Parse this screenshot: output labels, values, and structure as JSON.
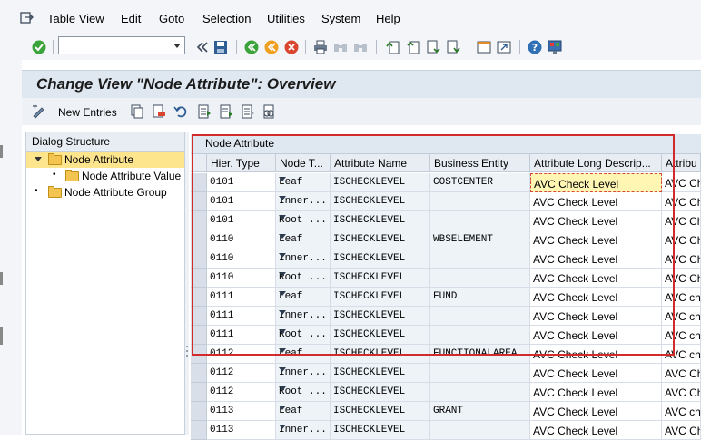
{
  "menu": {
    "items": [
      "Table View",
      "Edit",
      "Goto",
      "Selection",
      "Utilities",
      "System",
      "Help"
    ]
  },
  "toolbar": {
    "command_value": "",
    "icons": [
      "check-icon",
      "chevrons-left-icon",
      "save-icon",
      "back-icon",
      "exit-icon",
      "cancel-icon",
      "print-icon",
      "find-icon",
      "find-next-icon",
      "first-page-icon",
      "previous-page-icon",
      "next-page-icon",
      "last-page-icon",
      "create-session-icon",
      "shortcut-icon",
      "help-icon",
      "customize-layout-icon"
    ]
  },
  "title": "Change View \"Node Attribute\": Overview",
  "app_toolbar": {
    "new_entries_label": "New Entries"
  },
  "tree": {
    "header": "Dialog Structure",
    "items": [
      {
        "label": "Node Attribute",
        "selected": true
      },
      {
        "label": "Node Attribute Value"
      },
      {
        "label": "Node Attribute Group"
      }
    ]
  },
  "table": {
    "title": "Node Attribute",
    "columns": [
      "Hier. Type",
      "Node T...",
      "Attribute Name",
      "Business Entity",
      "Attribute Long Descrip...",
      "Attribu"
    ],
    "rows": [
      [
        "0101",
        "Leaf",
        "ISCHECKLEVEL",
        "COSTCENTER",
        "AVC Check Level",
        "AVC Ch"
      ],
      [
        "0101",
        "Inner...",
        "ISCHECKLEVEL",
        "",
        "AVC Check Level",
        "AVC Ch"
      ],
      [
        "0101",
        "Root ...",
        "ISCHECKLEVEL",
        "",
        "AVC Check Level",
        "AVC Ch"
      ],
      [
        "0110",
        "Leaf",
        "ISCHECKLEVEL",
        "WBSELEMENT",
        "AVC Check Level",
        "AVC Ch"
      ],
      [
        "0110",
        "Inner...",
        "ISCHECKLEVEL",
        "",
        "AVC Check Level",
        "AVC Ch"
      ],
      [
        "0110",
        "Root ...",
        "ISCHECKLEVEL",
        "",
        "AVC Check Level",
        "AVC Ch"
      ],
      [
        "0111",
        "Leaf",
        "ISCHECKLEVEL",
        "FUND",
        "AVC Check Level",
        "AVC ch"
      ],
      [
        "0111",
        "Inner...",
        "ISCHECKLEVEL",
        "",
        "AVC Check Level",
        "AVC ch"
      ],
      [
        "0111",
        "Root ...",
        "ISCHECKLEVEL",
        "",
        "AVC Check Level",
        "AVC ch"
      ],
      [
        "0112",
        "Leaf",
        "ISCHECKLEVEL",
        "FUNCTIONALAREA",
        "AVC Check Level",
        "AVC ch"
      ],
      [
        "0112",
        "Inner...",
        "ISCHECKLEVEL",
        "",
        "AVC Check Level",
        "AVC Ch"
      ],
      [
        "0112",
        "Root ...",
        "ISCHECKLEVEL",
        "",
        "AVC Check Level",
        "AVC Ch"
      ],
      [
        "0113",
        "Leaf",
        "ISCHECKLEVEL",
        "GRANT",
        "AVC Check Level",
        "AVC ch"
      ],
      [
        "0113",
        "Inner...",
        "ISCHECKLEVEL",
        "",
        "AVC Check Level",
        "AVC Ch"
      ]
    ]
  }
}
